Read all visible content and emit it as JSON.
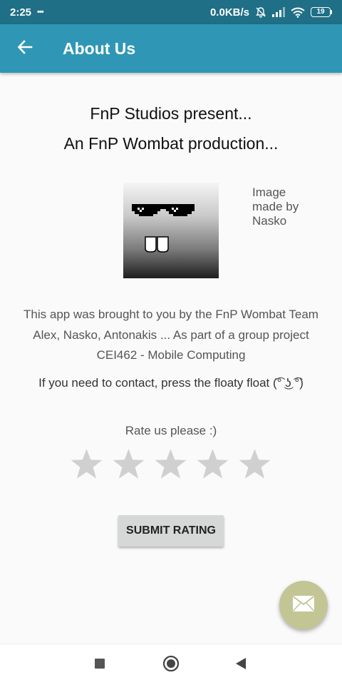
{
  "status_bar": {
    "time": "2:25",
    "notification_dots": "•••",
    "network_speed": "0.0KB/s",
    "battery": "19"
  },
  "app_bar": {
    "title": "About Us",
    "back_icon": "arrow-back-icon",
    "color": "#2f97b5"
  },
  "intro": {
    "line1": "FnP Studios present...",
    "line2": "An FnP Wombat production..."
  },
  "image": {
    "icon": "wombat-sunglasses-logo",
    "credit": "Image made by Nasko"
  },
  "description": {
    "line1": "This app was brought to you by the FnP Wombat Team",
    "line2": "Alex, Nasko, Antonakis ... As part of a group project",
    "line3": "CEI462 - Mobile Computing"
  },
  "contact": "If you need to contact, press the floaty float (͡° ͜ʖ ͡°)",
  "rating": {
    "label": "Rate us please :)",
    "max_stars": 5,
    "value": 0,
    "star_color": "#d0d0d0"
  },
  "submit_button": "SUBMIT RATING",
  "fab": {
    "icon": "mail-icon",
    "color": "#c3c595"
  },
  "nav_bar": {
    "recents_icon": "recents-square-icon",
    "home_icon": "home-circle-icon",
    "back_icon": "back-triangle-icon"
  }
}
